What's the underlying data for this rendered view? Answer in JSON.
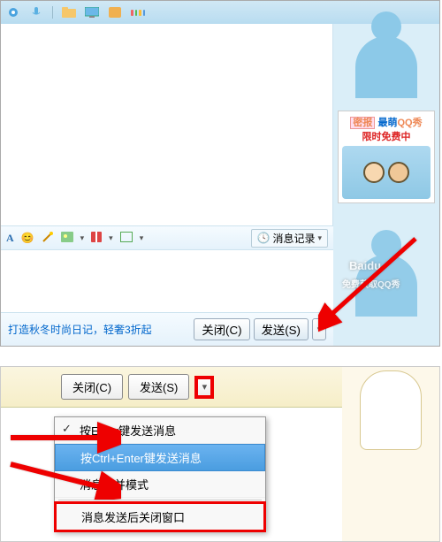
{
  "toolbar_icons": [
    "camera-icon",
    "mic-icon",
    "folder-icon",
    "screen-icon",
    "app-icon",
    "apps-icon"
  ],
  "promo": {
    "tag": "密报",
    "line1a": "最萌",
    "line1b": "QQ秀",
    "line2": "限时免费中"
  },
  "format_bar": {
    "font_label": "A",
    "history_label": "消息记录"
  },
  "footer": {
    "promo_text": "打造秋冬时尚日记，轻奢3折起",
    "close_label": "关闭(C)",
    "send_label": "发送(S)"
  },
  "watermark": {
    "brand": "Baidu",
    "sub": "免费获取QQ秀"
  },
  "zoom": {
    "close_label": "关闭(C)",
    "send_label": "发送(S)"
  },
  "menu": {
    "opt1": "按Enter键发送消息",
    "opt2": "按Ctrl+Enter键发送消息",
    "opt3": "消息合并模式",
    "opt4": "消息发送后关闭窗口"
  }
}
